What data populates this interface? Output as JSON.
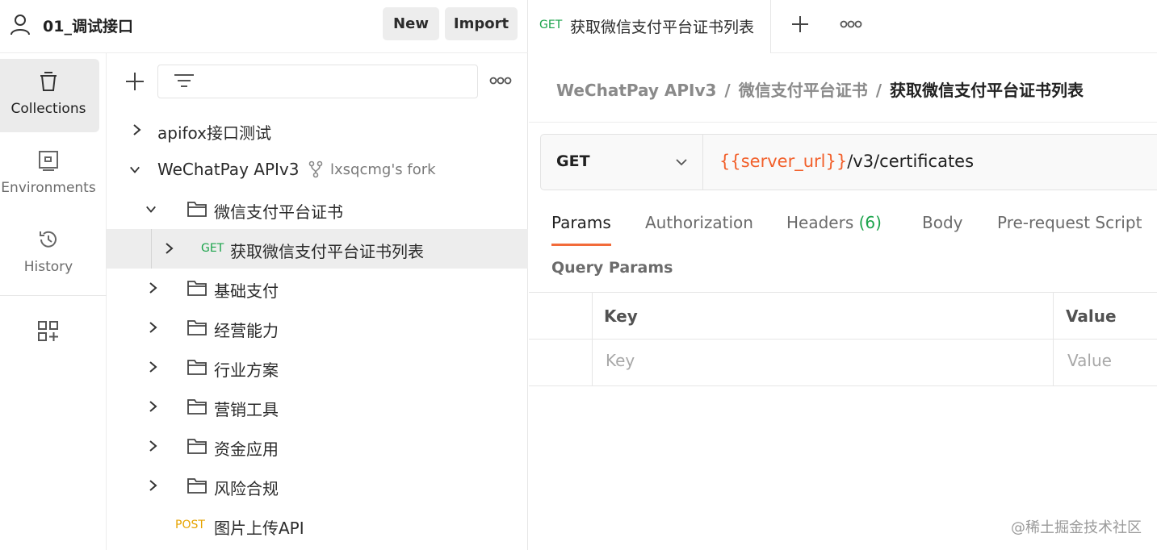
{
  "workspace": {
    "name": "01_调试接口",
    "new_label": "New",
    "import_label": "Import"
  },
  "rail": {
    "items": [
      {
        "label": "Collections",
        "icon": "collections-icon",
        "active": true
      },
      {
        "label": "Environments",
        "icon": "environments-icon",
        "active": false
      },
      {
        "label": "History",
        "icon": "history-icon",
        "active": false
      }
    ]
  },
  "tree": [
    {
      "label": "apifox接口测试",
      "type": "collection",
      "expanded": false
    },
    {
      "label": "WeChatPay APIv3",
      "type": "collection",
      "expanded": true,
      "fork": "lxsqcmg's fork"
    },
    {
      "label": "微信支付平台证书",
      "type": "folder",
      "expanded": true
    },
    {
      "label": "获取微信支付平台证书列表",
      "type": "request",
      "method": "GET",
      "selected": true
    },
    {
      "label": "基础支付",
      "type": "folder",
      "expanded": false
    },
    {
      "label": "经营能力",
      "type": "folder",
      "expanded": false
    },
    {
      "label": "行业方案",
      "type": "folder",
      "expanded": false
    },
    {
      "label": "营销工具",
      "type": "folder",
      "expanded": false
    },
    {
      "label": "资金应用",
      "type": "folder",
      "expanded": false
    },
    {
      "label": "风险合规",
      "type": "folder",
      "expanded": false
    },
    {
      "label": "图片上传API",
      "type": "request",
      "method": "POST"
    }
  ],
  "open_tab": {
    "method": "GET",
    "title": "获取微信支付平台证书列表"
  },
  "breadcrumb": [
    "WeChatPay APIv3",
    "/",
    "微信支付平台证书",
    "/",
    "获取微信支付平台证书列表"
  ],
  "request": {
    "method": "GET",
    "url_var": "{{server_url}}",
    "url_path": "/v3/certificates"
  },
  "request_tabs": {
    "params": "Params",
    "authorization": "Authorization",
    "headers": "Headers",
    "headers_count": "(6)",
    "body": "Body",
    "prerequest": "Pre-request Script"
  },
  "query_params": {
    "title": "Query Params",
    "col_key": "Key",
    "col_value": "Value",
    "placeholder_key": "Key",
    "placeholder_value": "Value"
  },
  "watermark": "@稀土掘金技术社区",
  "colors": {
    "get": "#1aa34a",
    "post": "#e6a300",
    "accent": "#f26b3a",
    "variable": "#f2602b"
  }
}
